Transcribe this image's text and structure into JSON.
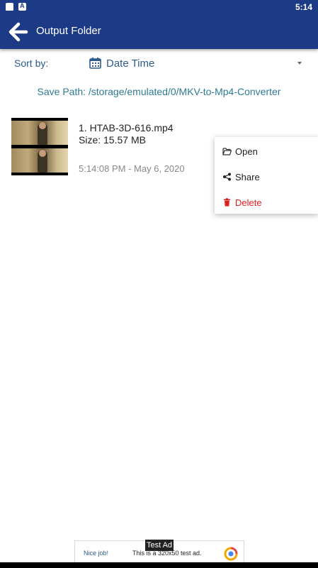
{
  "status_bar": {
    "time": "5:14"
  },
  "app_bar": {
    "title": "Output Folder"
  },
  "sort": {
    "label": "Sort by:",
    "value": "Date Time"
  },
  "save_path": "Save Path: /storage/emulated/0/MKV-to-Mp4-Converter",
  "items": [
    {
      "title": "1. HTAB-3D-616.mp4",
      "size": "Size: 15.57 MB",
      "date": "5:14:08 PM - May 6, 2020"
    }
  ],
  "context_menu": {
    "items": [
      {
        "label": "Open",
        "icon": "folder-open-icon"
      },
      {
        "label": "Share",
        "icon": "share-icon"
      },
      {
        "label": "Delete",
        "icon": "trash-icon"
      }
    ]
  },
  "ad": {
    "badge": "Test Ad",
    "nice": "Nice job!",
    "text": "This is a 320x50 test ad."
  },
  "colors": {
    "primary": "#1d3a86",
    "accent_text": "#2c5a8c",
    "delete": "#e0201c"
  }
}
